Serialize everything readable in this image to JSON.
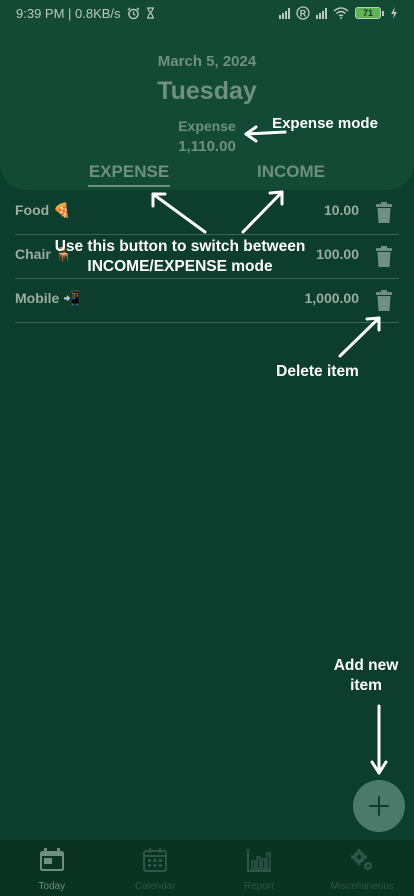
{
  "status_bar": {
    "time": "9:39 PM | 0.8KB/s",
    "alarm_icon": "alarm-icon",
    "battery_level": "71"
  },
  "header": {
    "date": "March 5, 2024",
    "day": "Tuesday",
    "mode_label": "Expense",
    "total": "1,110.00"
  },
  "tabs": [
    {
      "label": "EXPENSE",
      "active": true
    },
    {
      "label": "INCOME",
      "active": false
    }
  ],
  "items": [
    {
      "name": "Food 🍕",
      "amount": "10.00"
    },
    {
      "name": "Chair 🪑",
      "amount": "100.00"
    },
    {
      "name": "Mobile 📲",
      "amount": "1,000.00"
    }
  ],
  "annotations": {
    "expense_mode": "Expense mode",
    "switch_line1": "Use  this button  to switch between",
    "switch_line2": "INCOME/EXPENSE mode",
    "delete_item": "Delete item",
    "add_new_item": "Add new item"
  },
  "nav": [
    {
      "label": "Today",
      "icon": "calendar-today-icon",
      "active": true
    },
    {
      "label": "Calendar",
      "icon": "calendar-grid-icon",
      "active": false
    },
    {
      "label": "Report",
      "icon": "bar-chart-icon",
      "active": false
    },
    {
      "label": "Miscellaneous",
      "icon": "gears-icon",
      "active": false
    }
  ],
  "colors": {
    "background": "#0d3d2c",
    "header_card": "#124a36",
    "muted_text": "#6e8f82",
    "fab": "#4b7a6b",
    "battery": "#5fb352"
  }
}
